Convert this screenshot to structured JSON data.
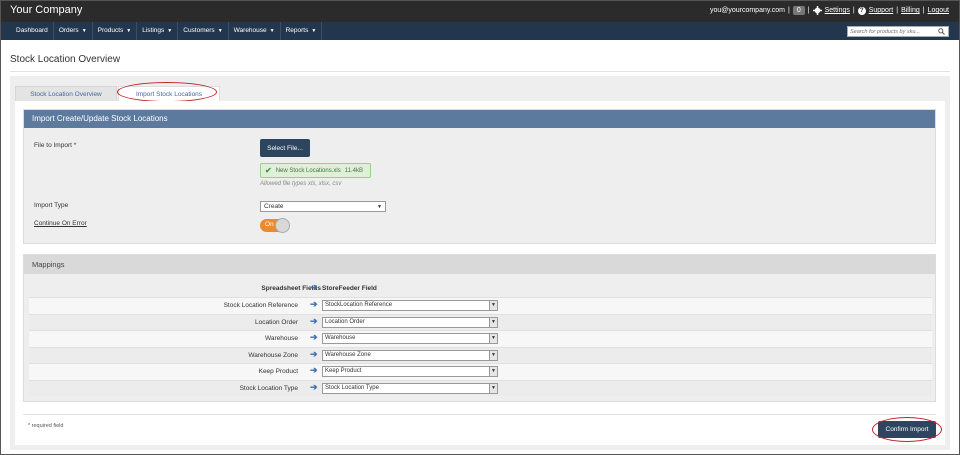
{
  "header": {
    "brand": "Your Company",
    "user_email": "you@yourcompany.com",
    "badge_count": "0",
    "settings": "Settings",
    "support": "Support",
    "billing": "Billing",
    "logout": "Logout"
  },
  "nav": {
    "items": [
      {
        "label": "Dashboard",
        "dropdown": false
      },
      {
        "label": "Orders",
        "dropdown": true
      },
      {
        "label": "Products",
        "dropdown": true
      },
      {
        "label": "Listings",
        "dropdown": true
      },
      {
        "label": "Customers",
        "dropdown": true
      },
      {
        "label": "Warehouse",
        "dropdown": true
      },
      {
        "label": "Reports",
        "dropdown": true
      }
    ],
    "search_placeholder": "Search for products by sku..."
  },
  "page": {
    "title": "Stock Location Overview",
    "tabs": [
      "Stock Location Overview",
      "Import Stock Locations"
    ],
    "active_tab": "Import Stock Locations"
  },
  "import_panel": {
    "heading": "Import Create/Update Stock Locations",
    "file_label": "File to Import *",
    "select_file_button": "Select File...",
    "file_name": "New Stock Locations.xls",
    "file_size": "11.4kB",
    "allowed_types": "Allowed file types xls, xlsx, csv",
    "import_type_label": "Import Type",
    "import_type_value": "Create",
    "continue_on_error_label": "Continue On Error",
    "continue_on_error_state": "On"
  },
  "mappings": {
    "heading": "Mappings",
    "col_spreadsheet": "Spreadsheet Fields",
    "col_storefeeder": "StoreFeeder Field",
    "rows": [
      {
        "field": "Stock Location Reference",
        "mapped": "StockLocation Reference"
      },
      {
        "field": "Location Order",
        "mapped": "Location Order"
      },
      {
        "field": "Warehouse",
        "mapped": "Warehouse"
      },
      {
        "field": "Warehouse Zone",
        "mapped": "Warehouse Zone"
      },
      {
        "field": "Keep Product",
        "mapped": "Keep Product"
      },
      {
        "field": "Stock Location Type",
        "mapped": "Stock Location Type"
      }
    ]
  },
  "footer": {
    "required_note": "* required field",
    "confirm_button": "Confirm Import"
  },
  "colors": {
    "topbar": "#2b2b2b",
    "navbar": "#22364d",
    "panel_header": "#5b7a9e",
    "button": "#2e4560",
    "toggle_on": "#f0892e",
    "highlight_ring": "#c0232c"
  }
}
